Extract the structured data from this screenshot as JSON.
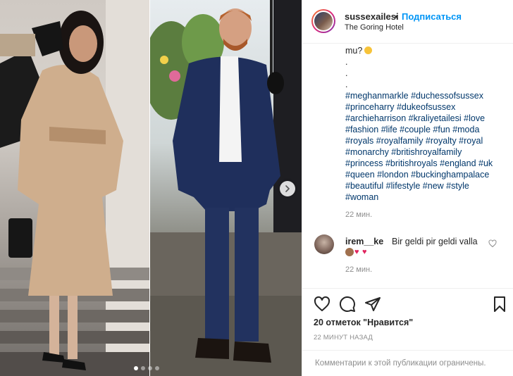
{
  "post": {
    "images": [
      {
        "name": "photo-woman-in-camel-coat"
      },
      {
        "name": "photo-man-in-navy-suit"
      }
    ],
    "carousel": {
      "current": 1,
      "total": 4
    }
  },
  "header": {
    "username": "sussexailesi",
    "separator": "•",
    "follow_label": "Подписаться",
    "location": "The Goring Hotel"
  },
  "caption": {
    "first_line": "mu?",
    "dots": [
      ".",
      ".",
      "."
    ],
    "hashtag_lines": [
      "#meghanmarkle #duchessofsussex",
      "#princeharry #dukeofsussex",
      "#archieharrison #kraliyetailesi #love",
      "#fashion #life #couple #fun #moda",
      "#royals #royalfamily #royalty #royal",
      "#monarchy #britishroyalfamily",
      "#princess #britishroyals #england #uk",
      "#queen #london #buckinghampalace",
      "#beautiful #lifestyle #new #style",
      "#woman"
    ],
    "time": "22 мин."
  },
  "comment": {
    "username": "irem__ke",
    "text": "Bir geldi pir geldi valla",
    "emojis": [
      "see-no-evil-monkey",
      "hearts",
      "hearts"
    ],
    "time": "22 мин."
  },
  "actions": {
    "icons": [
      "heart-icon",
      "comment-icon",
      "share-icon",
      "bookmark-icon"
    ]
  },
  "likes_text": "20 отметок \"Нравится\"",
  "post_time": "22 МИНУТ НАЗАД",
  "comments_disabled_text": "Комментарии к этой публикации ограничены.",
  "colors": {
    "accent": "#0095f6",
    "hashtag": "#00376b",
    "muted": "#8e8e8e",
    "text": "#262626",
    "border": "#efefef"
  }
}
